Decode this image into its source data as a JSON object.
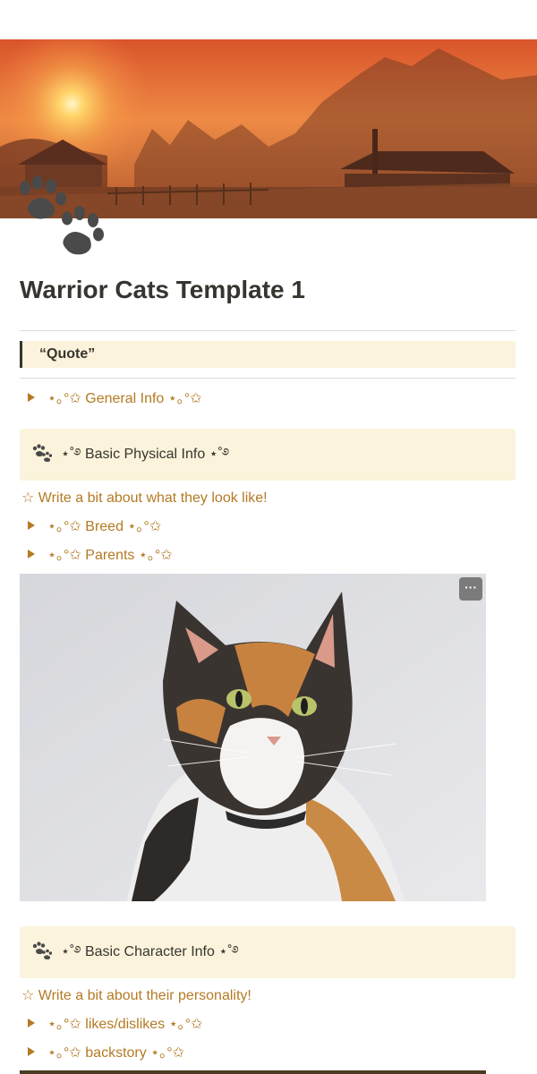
{
  "page": {
    "title": "Warrior Cats Template 1",
    "icon": "paw-prints-icon",
    "cover": "sunset-village-photo"
  },
  "quote": {
    "text": "“Quote”"
  },
  "sections": {
    "general_info_toggle": "⋆｡°✩ General Info ⋆｡°✩",
    "physical_callout": "⋆˚࿔ Basic Physical Info ⋆˚࿔",
    "physical_prompt": "☆ Write a bit about what they look like!",
    "breed_toggle": "⋆｡°✩ Breed ⋆｡°✩",
    "parents_toggle": "⋆｡°✩ Parents ⋆｡°✩",
    "character_callout": "⋆˚࿔ Basic Character Info ⋆˚࿔",
    "character_prompt": "☆ Write a bit about their personality!",
    "likes_toggle": "⋆｡°✩ likes/dislikes ⋆｡°✩",
    "backstory_toggle": "⋆｡°✩ backstory ⋆｡°✩"
  },
  "image": {
    "subject": "calico-cat-photo",
    "menu_label": "···"
  },
  "colors": {
    "accent_text": "#b47a23",
    "callout_bg": "#fbf3db",
    "title_text": "#37352f"
  }
}
